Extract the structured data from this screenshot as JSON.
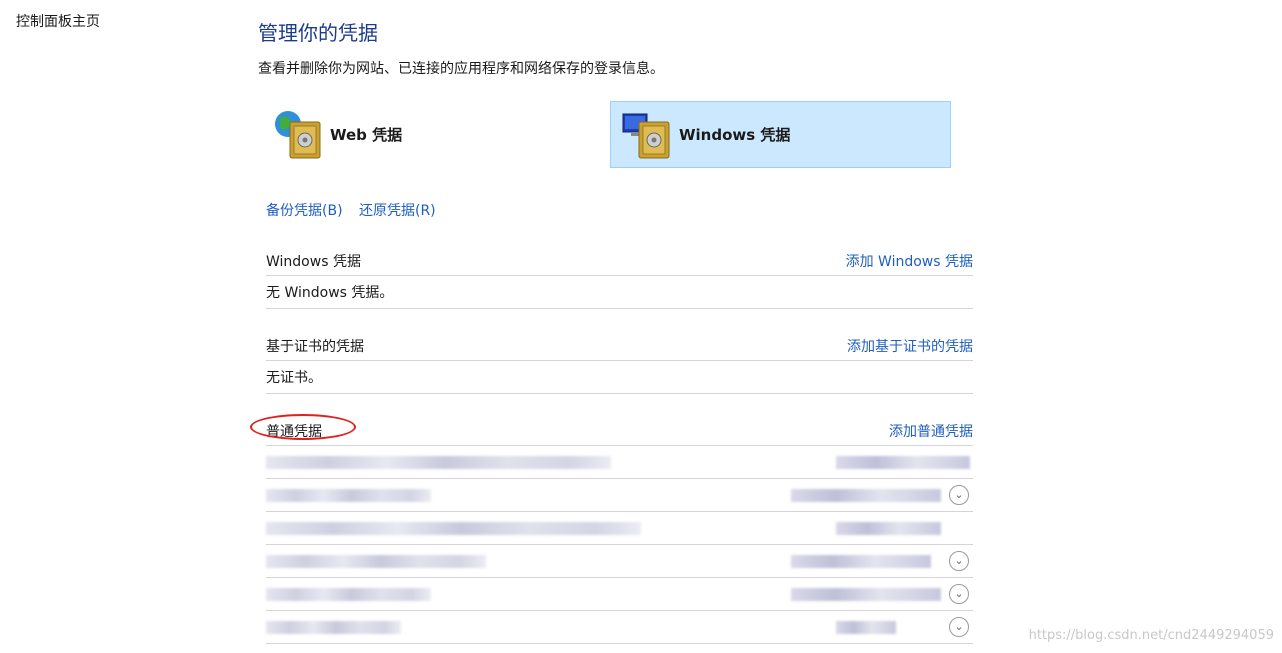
{
  "sidebar": {
    "home_link": "控制面板主页"
  },
  "header": {
    "title": "管理你的凭据",
    "description": "查看并删除你为网站、已连接的应用程序和网络保存的登录信息。"
  },
  "tiles": {
    "web": {
      "label": "Web 凭据",
      "icon": "web-credentials-vault-icon"
    },
    "windows": {
      "label": "Windows 凭据",
      "icon": "windows-credentials-vault-icon",
      "selected": true
    }
  },
  "actions": {
    "backup": "备份凭据(B)",
    "restore": "还原凭据(R)"
  },
  "sections": {
    "windows": {
      "title": "Windows 凭据",
      "add": "添加 Windows 凭据",
      "empty": "无 Windows 凭据。"
    },
    "certificate": {
      "title": "基于证书的凭据",
      "add": "添加基于证书的凭据",
      "empty": "无证书。"
    },
    "generic": {
      "title": "普通凭据",
      "add": "添加普通凭据"
    }
  },
  "annotation": {
    "color": "#e0201c",
    "shape": "ellipse-around-generic-title"
  },
  "watermark": "https://blog.csdn.net/cnd2449294059",
  "colors": {
    "link": "#1f5fbf",
    "title": "#1c3d8c",
    "selected_tile": "#cce8ff"
  }
}
